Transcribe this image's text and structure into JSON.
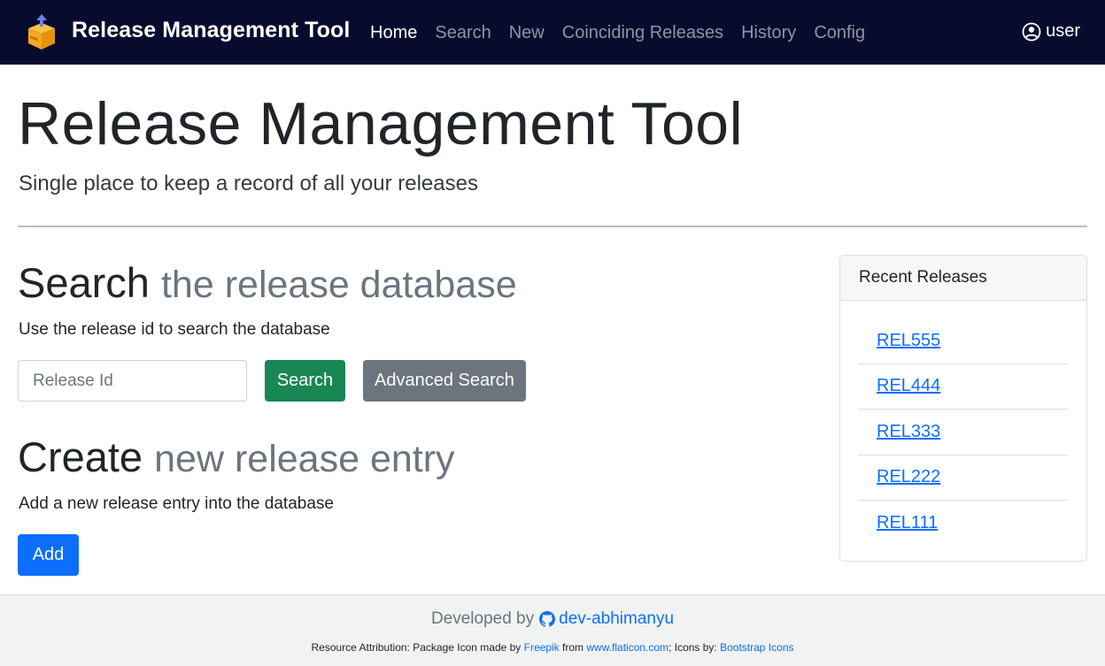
{
  "navbar": {
    "brand": "Release Management Tool",
    "brand_icon": "package-icon",
    "links": [
      "Home",
      "Search",
      "New",
      "Coinciding Releases",
      "History",
      "Config"
    ],
    "active": "Home",
    "user_label": "user",
    "user_icon": "person-circle-icon"
  },
  "hero": {
    "title": "Release Management Tool",
    "subtitle": "Single place to keep a record of all your releases"
  },
  "search_section": {
    "title_main": "Search",
    "title_muted": "the release database",
    "description": "Use the release id to search the database",
    "input_placeholder": "Release Id",
    "search_button": "Search",
    "advanced_button": "Advanced Search"
  },
  "create_section": {
    "title_main": "Create",
    "title_muted": "new release entry",
    "description": "Add a new release entry into the database",
    "add_button": "Add"
  },
  "recent": {
    "header": "Recent Releases",
    "items": [
      "REL555",
      "REL444",
      "REL333",
      "REL222",
      "REL111"
    ]
  },
  "footer": {
    "developed_by": "Developed by",
    "developer": "dev-abhimanyu",
    "developer_icon": "github-icon",
    "attr_prefix": "Resource Attribution: Package Icon made by",
    "freepik": "Freepik",
    "from": "from",
    "flaticon": "www.flaticon.com",
    "icons_by": "; Icons by:",
    "bootstrap_icons": "Bootstrap Icons"
  },
  "colors": {
    "navbar_bg": "#070c2f",
    "primary": "#0d6efd",
    "success": "#198754",
    "secondary": "#6c757d"
  }
}
